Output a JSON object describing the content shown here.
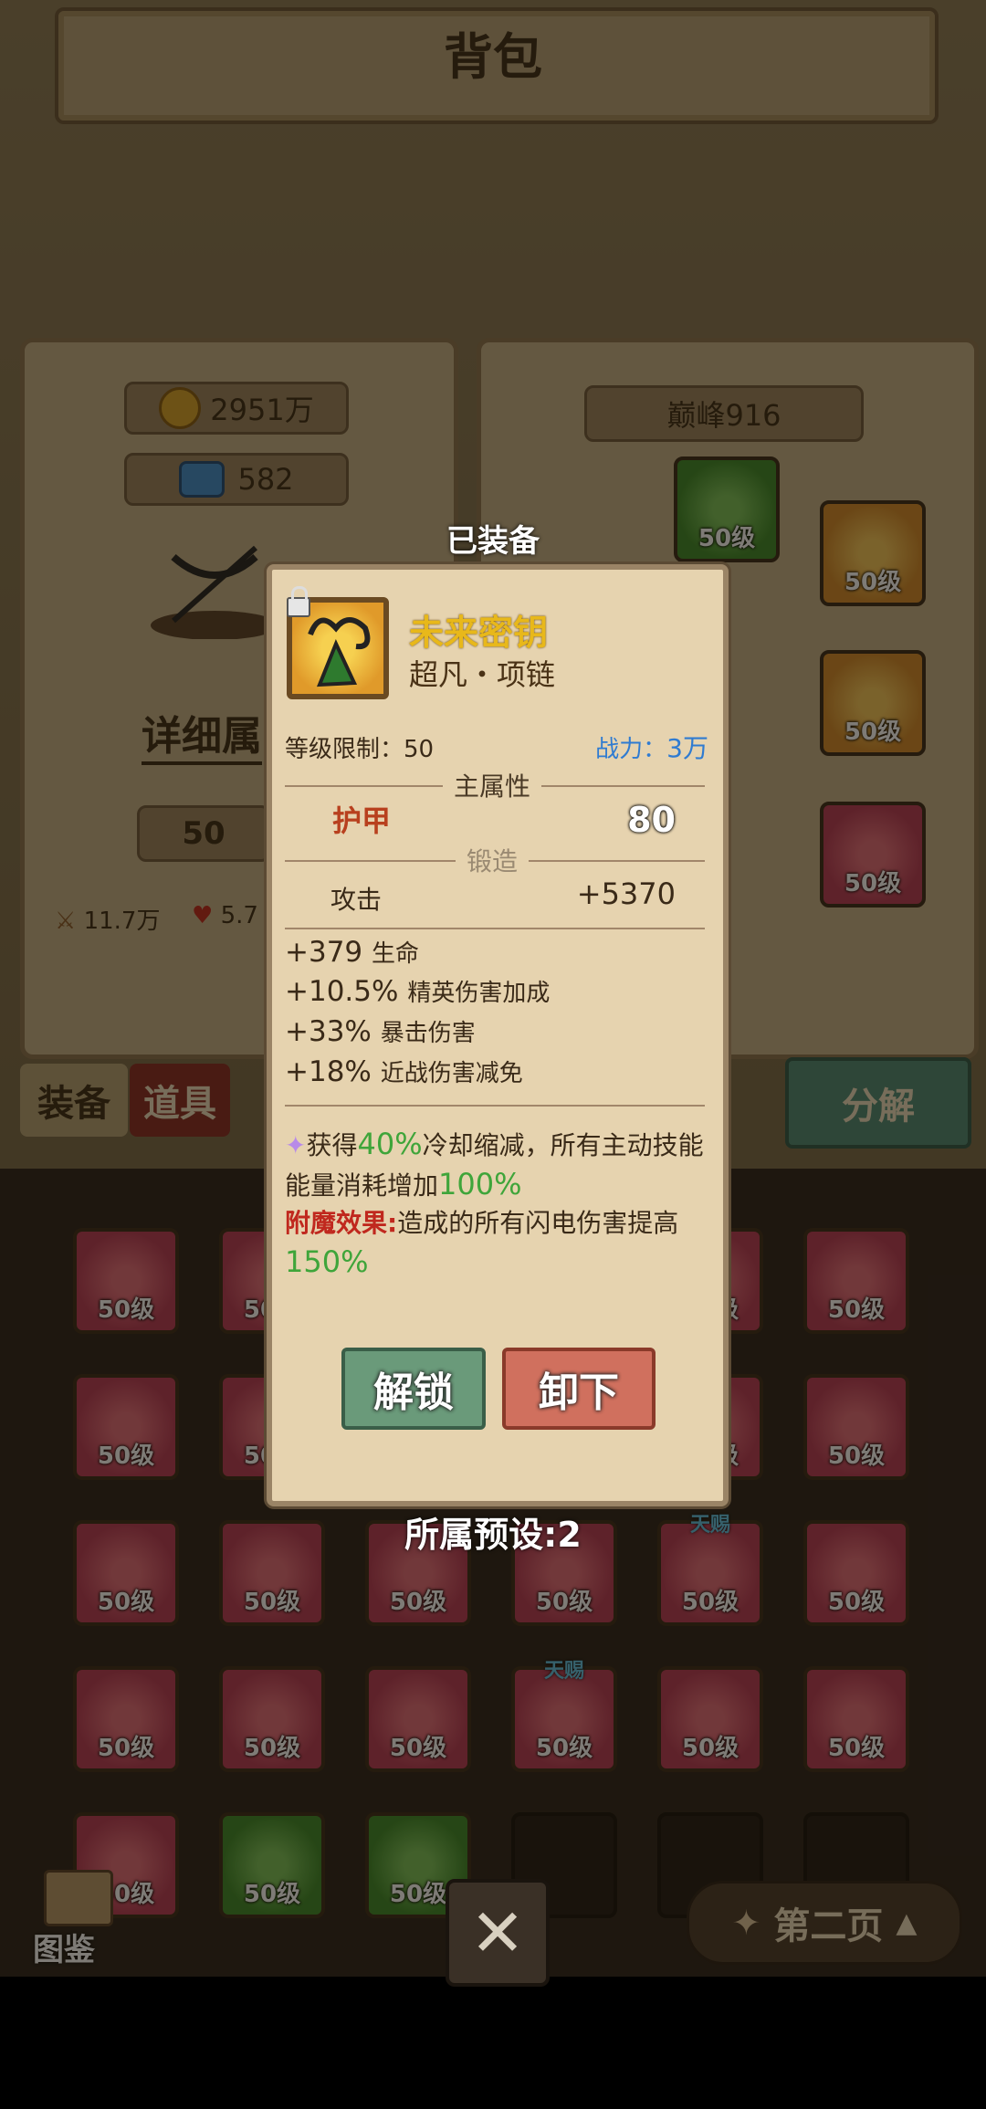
{
  "header": {
    "title": "背包"
  },
  "resources": {
    "gold": "2951万",
    "gems": "582"
  },
  "left_panel": {
    "detail_button": "详细属",
    "level_badge": "50",
    "power_left": "11.7万",
    "hp_left": "5.7"
  },
  "right_panel": {
    "rank_label": "巅峰916"
  },
  "tabs": {
    "equipment": "装备",
    "items": "道具",
    "decompose": "分解"
  },
  "popup": {
    "equipped_label": "已装备",
    "item_name": "未来密钥",
    "item_type": "超凡・项链",
    "level_req": "等级限制：50",
    "combat_power_label": "战力：",
    "combat_power_value": "3万",
    "main_attr_title": "主属性",
    "main_attr_name": "护甲",
    "main_attr_value": "80",
    "forge_title": "锻造",
    "forge_attr_name": "攻击",
    "forge_attr_value": "+5370",
    "sub_stats": [
      {
        "value": "+379",
        "name": "生命"
      },
      {
        "value": "+10.5%",
        "name": "精英伤害加成"
      },
      {
        "value": "+33%",
        "name": "暴击伤害"
      },
      {
        "value": "+18%",
        "name": "近战伤害减免"
      }
    ],
    "effect": {
      "part1": "获得",
      "pct1": "40%",
      "part2": "冷却缩减，所有主动技能能量消耗增加",
      "pct2": "100%"
    },
    "enchant": {
      "label": "附魔效果:",
      "text": "造成的所有闪电伤害提高",
      "pct": "150%"
    },
    "unlock_button": "解锁",
    "unequip_button": "卸下",
    "preset_label": "所属预设:2"
  },
  "grid": {
    "slot_level": "50级",
    "tianci": "天赐"
  },
  "footer": {
    "codex": "图鉴",
    "page_label": "第二页"
  },
  "colors": {
    "accent_gold": "#e8b81a",
    "green_text": "#3fa53a",
    "blue_text": "#2f7bd1",
    "red_text": "#c0281e"
  }
}
